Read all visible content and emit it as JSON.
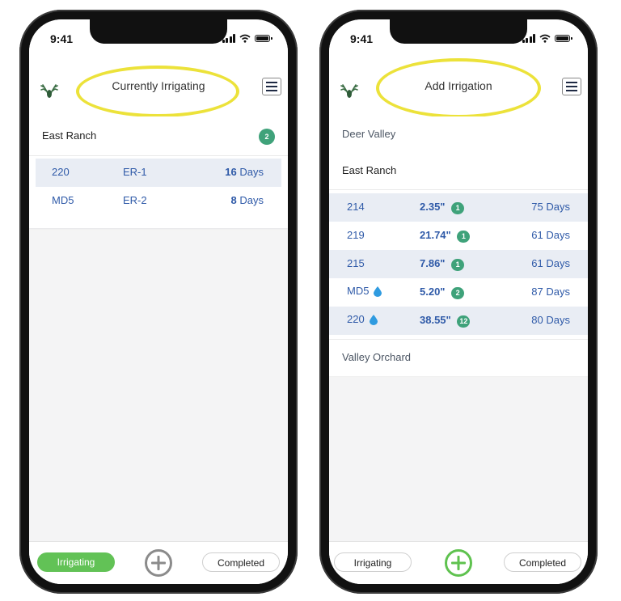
{
  "colors": {
    "highlight": "#ece23a",
    "badge": "#3fa27a",
    "link_blue": "#2f5aa8",
    "active_tab": "#62c256",
    "add_green": "#5fc24f"
  },
  "left": {
    "status": {
      "time": "9:41"
    },
    "header": {
      "title": "Currently Irrigating",
      "logo_icon": "deer-antler-icon",
      "menu_icon": "hamburger-icon"
    },
    "ranch": {
      "name": "East Ranch",
      "count": "2"
    },
    "rows": [
      {
        "field": "220",
        "set": "ER-1",
        "days_num": "16",
        "days_label": "Days"
      },
      {
        "field": "MD5",
        "set": "ER-2",
        "days_num": "8",
        "days_label": "Days"
      }
    ],
    "tabs": {
      "left": "Irrigating",
      "right": "Completed",
      "add_icon": "plus-circle-icon"
    }
  },
  "right": {
    "status": {
      "time": "9:41"
    },
    "header": {
      "title": "Add Irrigation",
      "logo_icon": "deer-antler-icon",
      "menu_icon": "hamburger-icon"
    },
    "ranches": [
      "Deer Valley",
      "East Ranch",
      "Valley Orchard"
    ],
    "rows": [
      {
        "field": "214",
        "amount": "2.35\"",
        "count": "1",
        "days": "75 Days",
        "drop": false
      },
      {
        "field": "219",
        "amount": "21.74\"",
        "count": "1",
        "days": "61 Days",
        "drop": false
      },
      {
        "field": "215",
        "amount": "7.86\"",
        "count": "1",
        "days": "61 Days",
        "drop": false
      },
      {
        "field": "MD5",
        "amount": "5.20\"",
        "count": "2",
        "days": "87 Days",
        "drop": true
      },
      {
        "field": "220",
        "amount": "38.55\"",
        "count": "12",
        "days": "80 Days",
        "drop": true
      }
    ],
    "tabs": {
      "left": "Irrigating",
      "right": "Completed",
      "add_icon": "plus-circle-icon"
    }
  }
}
